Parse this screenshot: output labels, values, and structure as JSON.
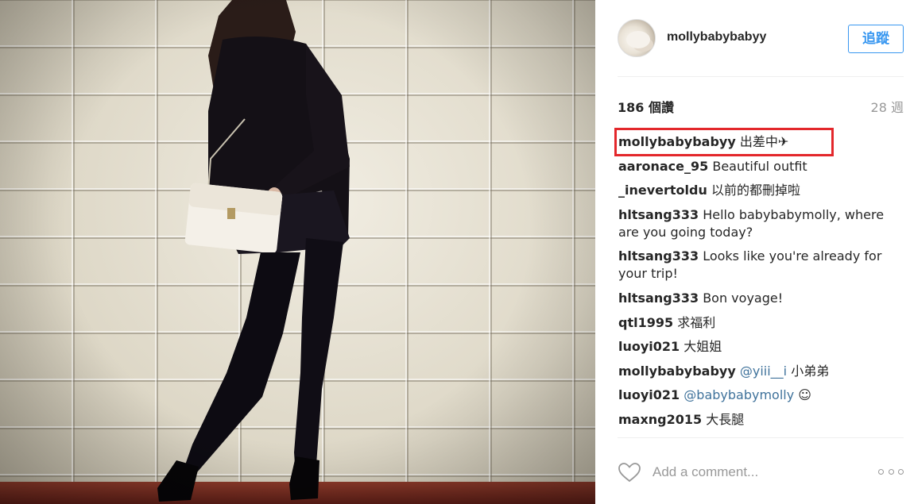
{
  "post": {
    "username": "mollybabybabyy",
    "follow_label": "追蹤",
    "likes": "186 個讚",
    "time_ago": "28 週"
  },
  "comments": [
    {
      "user": "mollybabybabyy",
      "text": "出差中✈"
    },
    {
      "user": "aaronace_95",
      "text": "Beautiful outfit"
    },
    {
      "user": "_inevertoldu",
      "text": "以前的都刪掉啦"
    },
    {
      "user": "hltsang333",
      "text": "Hello babybabymolly, where are you going today?"
    },
    {
      "user": "hltsang333",
      "text": "Looks like you're already for your trip!"
    },
    {
      "user": "hltsang333",
      "text": "Bon voyage!"
    },
    {
      "user": "qtl1995",
      "text": "求福利"
    },
    {
      "user": "luoyi021",
      "text": "大姐姐"
    },
    {
      "user": "mollybabybabyy",
      "mention": "@yiii__i",
      "text": "小弟弟"
    },
    {
      "user": "luoyi021",
      "mention": "@babybabymolly",
      "text": "☺"
    },
    {
      "user": "maxng2015",
      "text": "大長腿"
    }
  ],
  "footer": {
    "comment_placeholder": "Add a comment...",
    "like_icon": "heart-outline-icon",
    "more_icon": "more-options-icon"
  },
  "colors": {
    "accent": "#3897f0",
    "mention": "#3f729b",
    "highlight": "#e3272b"
  }
}
